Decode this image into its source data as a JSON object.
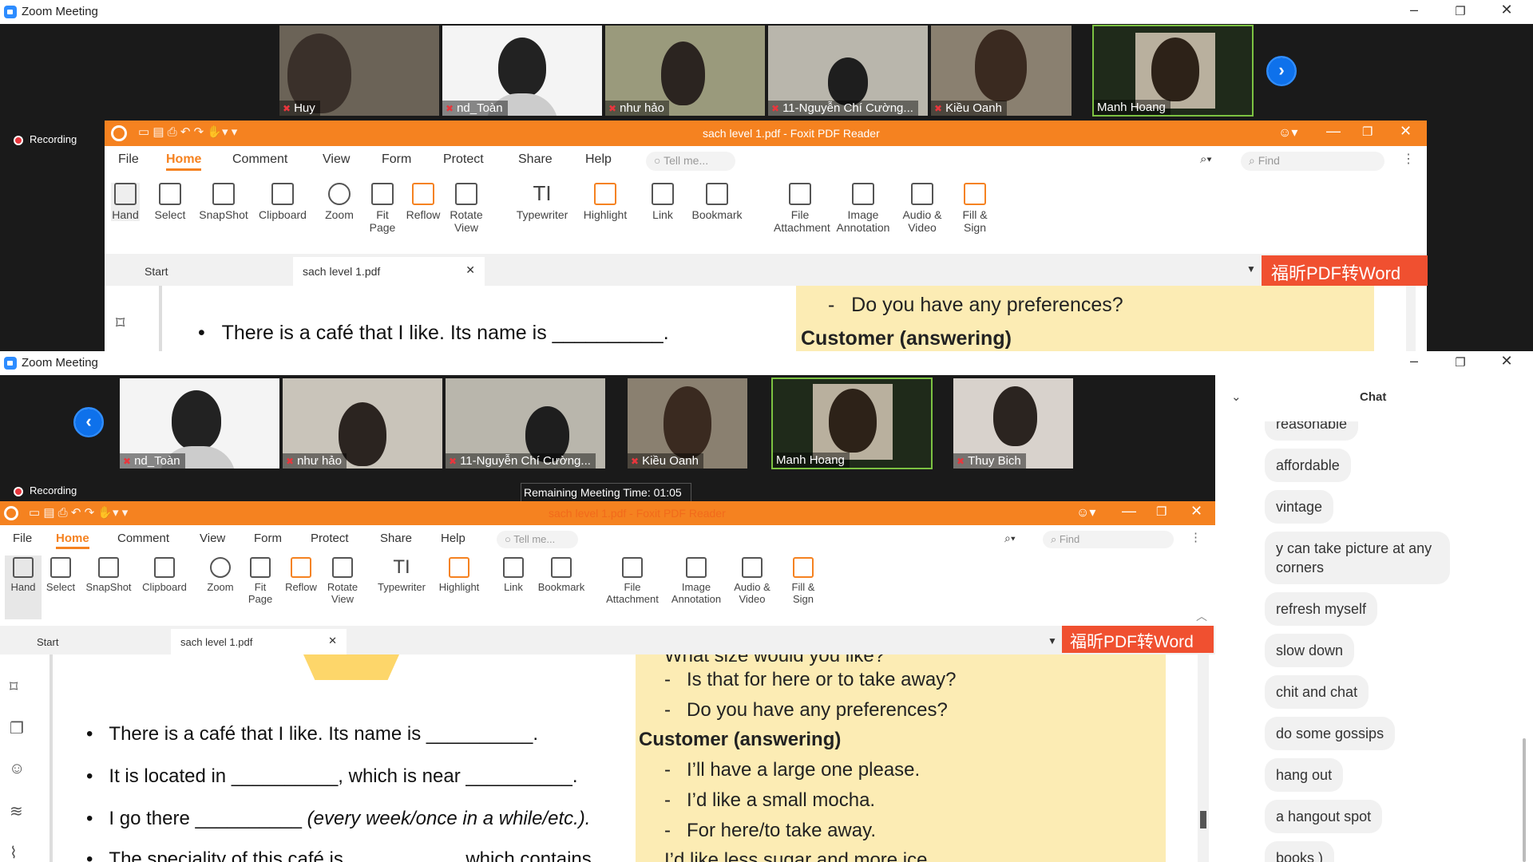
{
  "top_window": {
    "title": "Zoom Meeting",
    "recording": "Recording",
    "tiles": [
      {
        "name": "Huy"
      },
      {
        "name": "nd_Toàn"
      },
      {
        "name": "như hảo"
      },
      {
        "name": "11-Nguyễn Chí Cường..."
      },
      {
        "name": "Kiều Oanh"
      },
      {
        "name": "Manh Hoang"
      }
    ],
    "foxit": {
      "title": "sach level 1.pdf - Foxit PDF Reader",
      "menu": [
        "File",
        "Home",
        "Comment",
        "View",
        "Form",
        "Protect",
        "Share",
        "Help"
      ],
      "tell_me": "Tell me...",
      "find": "Find",
      "ribbon": [
        "Hand",
        "Select",
        "SnapShot",
        "Clipboard",
        "Zoom",
        "Fit Page",
        "Reflow",
        "Rotate View",
        "Typewriter",
        "Highlight",
        "Link",
        "Bookmark",
        "File Attachment",
        "Image Annotation",
        "Audio & Video",
        "Fill & Sign"
      ],
      "tabs": [
        "Start",
        "sach level 1.pdf"
      ],
      "banner": "福昕PDF转Word",
      "doc_left": "There is a café that I like. Its name is __________.",
      "doc_right1": "Do you have any preferences?",
      "doc_right2": "Customer (answering)"
    }
  },
  "bottom_window": {
    "title": "Zoom Meeting",
    "recording": "Recording",
    "remaining": "Remaining Meeting Time: 01:05",
    "tiles": [
      {
        "name": "nd_Toàn"
      },
      {
        "name": "như hảo"
      },
      {
        "name": "11-Nguyễn Chí Cường..."
      },
      {
        "name": "Kiều Oanh"
      },
      {
        "name": "Manh Hoang"
      },
      {
        "name": "Thuy Bich"
      }
    ],
    "foxit": {
      "title": "sach level 1.pdf - Foxit PDF Reader",
      "menu": [
        "File",
        "Home",
        "Comment",
        "View",
        "Form",
        "Protect",
        "Share",
        "Help"
      ],
      "tell_me": "Tell me...",
      "find": "Find",
      "ribbon": [
        "Hand",
        "Select",
        "SnapShot",
        "Clipboard",
        "Zoom",
        "Fit Page",
        "Reflow",
        "Rotate View",
        "Typewriter",
        "Highlight",
        "Link",
        "Bookmark",
        "File Attachment",
        "Image Annotation",
        "Audio & Video",
        "Fill & Sign"
      ],
      "tabs": [
        "Start",
        "sach level 1.pdf"
      ],
      "banner": "福昕PDF转Word",
      "doc_left": [
        "There is a café that I like. Its name is __________.",
        "It is located in __________, which is near __________.",
        "I go there __________ ",
        "The speciality of this café is __________, which contains"
      ],
      "doc_left_italic": "(every week/once in a while/etc.).",
      "doc_right": [
        "What size would you like?",
        "Is that for here or to take away?",
        "Do you have any preferences?",
        "Customer (answering)",
        "I’ll have a large one please.",
        "I’d like a small mocha.",
        "For here/to take away.",
        "I’d like less sugar and more ice."
      ]
    },
    "chat": {
      "title": "Chat",
      "messages": [
        "reasonable",
        "affordable",
        "vintage",
        "y can take picture at any corners",
        "refresh myself",
        "slow down",
        "chit and chat",
        "do some gossips",
        "hang out",
        "a hangout spot",
        "books )"
      ]
    }
  }
}
